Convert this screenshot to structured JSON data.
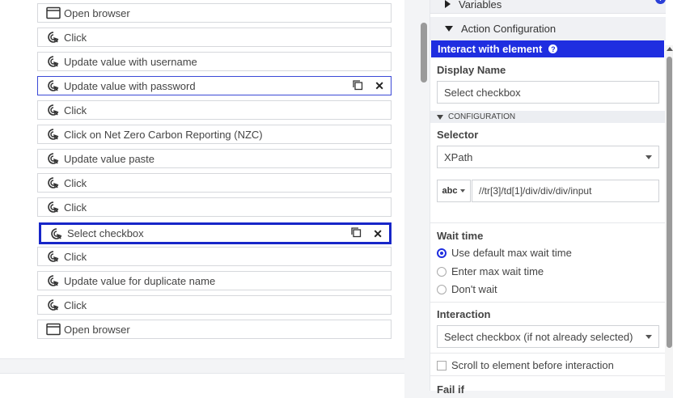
{
  "flow": {
    "steps": [
      {
        "label": "Open browser",
        "icon": "browser-window-icon"
      },
      {
        "label": "Click",
        "icon": "click-cursor-icon"
      },
      {
        "label": "Update value with username",
        "icon": "click-cursor-icon"
      },
      {
        "label": "Update value with password",
        "icon": "click-cursor-icon"
      },
      {
        "label": "Click",
        "icon": "click-cursor-icon"
      },
      {
        "label": "Click on Net Zero Carbon Reporting (NZC)",
        "icon": "click-cursor-icon"
      },
      {
        "label": "Update value paste",
        "icon": "click-cursor-icon"
      },
      {
        "label": "Click",
        "icon": "click-cursor-icon"
      },
      {
        "label": "Click",
        "icon": "click-cursor-icon"
      },
      {
        "label": "Select checkbox",
        "icon": "click-cursor-icon"
      },
      {
        "label": "Click",
        "icon": "click-cursor-icon"
      },
      {
        "label": "Update value for duplicate name",
        "icon": "click-cursor-icon"
      },
      {
        "label": "Click",
        "icon": "click-cursor-icon"
      },
      {
        "label": "Open browser",
        "icon": "browser-window-icon"
      }
    ]
  },
  "config": {
    "variables_label": "Variables",
    "action_config_label": "Action Configuration",
    "section_title": "Interact with element",
    "display_name_label": "Display Name",
    "display_name_value": "Select checkbox",
    "configuration_label": "CONFIGURATION",
    "selector_label": "Selector",
    "selector_value": "XPath",
    "xpath_type": "abc",
    "xpath_value": "//tr[3]/td[1]/div/div/div/input",
    "wait_time_label": "Wait time",
    "wait_options": [
      "Use default max wait time",
      "Enter max wait time",
      "Don't wait"
    ],
    "interaction_label": "Interaction",
    "interaction_value": "Select checkbox (if not already selected)",
    "scroll_label": "Scroll to element before interaction",
    "fail_if_label": "Fail if"
  },
  "colors": {
    "accent": "#1f2ee0",
    "selected_border": "#1726c8"
  }
}
